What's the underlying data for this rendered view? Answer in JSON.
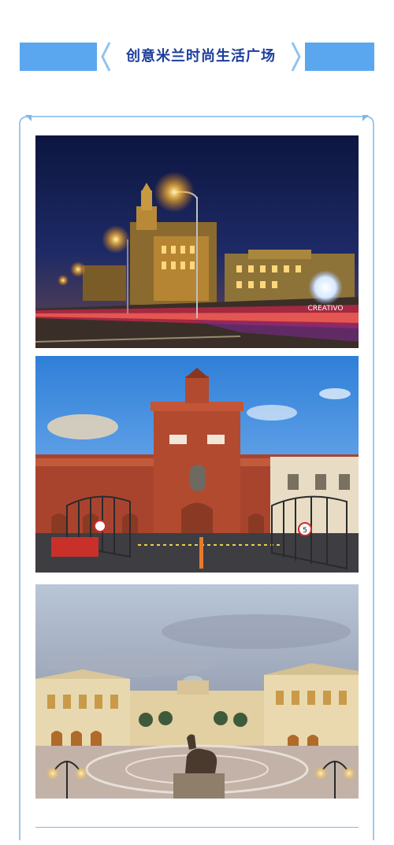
{
  "header": {
    "title": "创意米兰时尚生活广场"
  },
  "photos": [
    {
      "sign_text": "CREATIVO"
    },
    {
      "gate_sign": "5"
    },
    {}
  ],
  "colors": {
    "banner_blue": "#5aa7f0",
    "title_navy": "#1c3d9a",
    "frame_line": "#7fb8e8"
  }
}
